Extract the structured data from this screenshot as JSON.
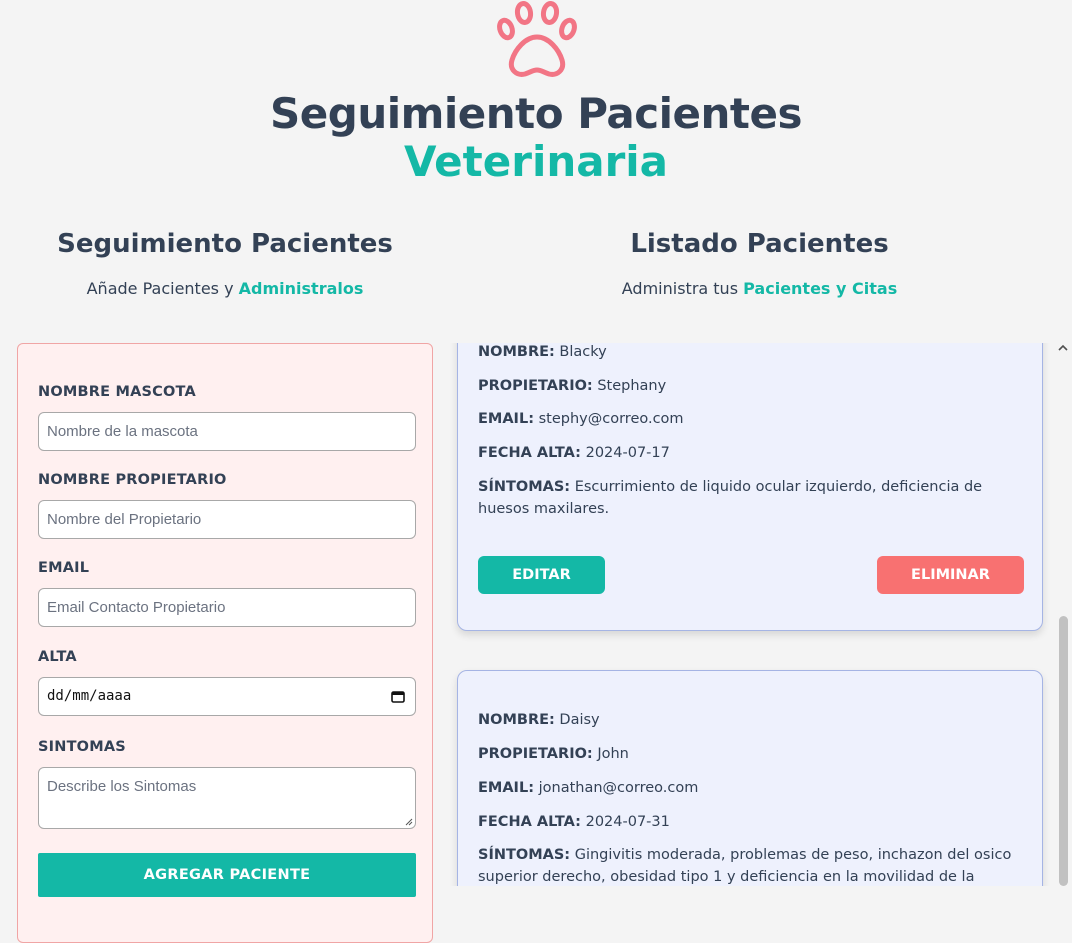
{
  "header": {
    "icon": "paw-icon",
    "title_main": "Seguimiento Pacientes",
    "title_accent": "Veterinaria"
  },
  "form_section": {
    "heading": "Seguimiento Pacientes",
    "subtitle_prefix": "Añade Pacientes y",
    "subtitle_highlight": "Administralos"
  },
  "list_section": {
    "heading": "Listado Pacientes",
    "subtitle_prefix": "Administra tus",
    "subtitle_highlight": "Pacientes y Citas"
  },
  "form": {
    "pet_label": "NOMBRE MASCOTA",
    "pet_placeholder": "Nombre de la mascota",
    "owner_label": "NOMBRE PROPIETARIO",
    "owner_placeholder": "Nombre del Propietario",
    "email_label": "EMAIL",
    "email_placeholder": "Email Contacto Propietario",
    "date_label": "ALTA",
    "date_value": "dd/mm/aaaa",
    "symptoms_label": "SINTOMAS",
    "symptoms_placeholder": "Describe los Sintomas",
    "submit_label": "AGREGAR PACIENTE"
  },
  "field_labels": {
    "name": "NOMBRE:",
    "owner": "PROPIETARIO:",
    "email": "EMAIL:",
    "date": "FECHA ALTA:",
    "symptoms": "SÍNTOMAS:"
  },
  "patients": [
    {
      "name": "Blacky",
      "owner": "Stephany",
      "email": "stephy@correo.com",
      "date": "2024-07-17",
      "symptoms": "Escurrimiento de liquido ocular izquierdo, deficiencia de huesos maxilares.",
      "edit_label": "EDITAR",
      "delete_label": "ELIMINAR"
    },
    {
      "name": "Daisy",
      "owner": "John",
      "email": "jonathan@correo.com",
      "date": "2024-07-31",
      "symptoms": "Gingivitis moderada, problemas de peso, inchazon del osico superior derecho, obesidad tipo 1 y deficiencia en la movilidad de la quijada."
    }
  ],
  "colors": {
    "accent": "#14b8a6",
    "paw": "#f27585",
    "danger": "#f87171",
    "text": "#334155",
    "card_bg": "#eef1fd",
    "form_bg": "#fff0f0"
  }
}
